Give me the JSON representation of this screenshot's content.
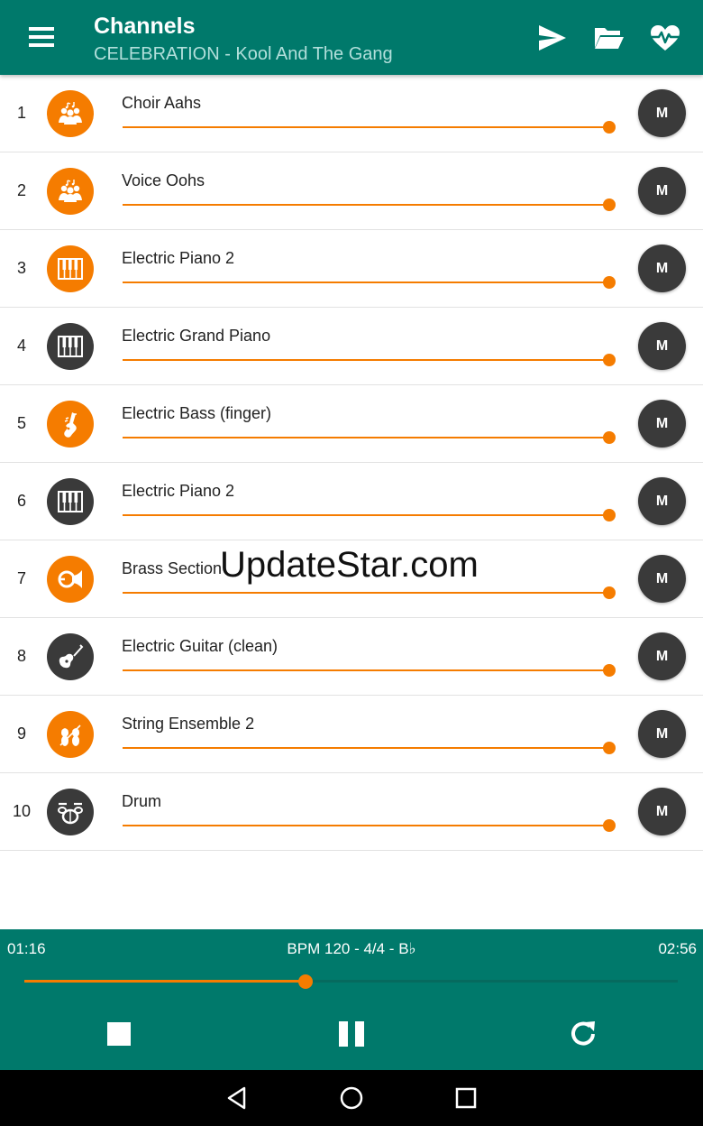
{
  "header": {
    "title": "Channels",
    "subtitle": "CELEBRATION - Kool And The Gang",
    "icons": [
      "menu-icon",
      "send-icon",
      "folder-open-icon",
      "heart-pulse-icon"
    ]
  },
  "colors": {
    "primary": "#00796b",
    "accent": "#f57c00",
    "dark": "#3a3a3a"
  },
  "channels": [
    {
      "number": "1",
      "name": "Choir Aahs",
      "icon": "choir",
      "tone": "orange",
      "volume": 1.0,
      "mute_label": "M"
    },
    {
      "number": "2",
      "name": "Voice Oohs",
      "icon": "choir",
      "tone": "orange",
      "volume": 1.0,
      "mute_label": "M"
    },
    {
      "number": "3",
      "name": "Electric Piano 2",
      "icon": "piano",
      "tone": "orange",
      "volume": 1.0,
      "mute_label": "M"
    },
    {
      "number": "4",
      "name": "Electric Grand Piano",
      "icon": "piano",
      "tone": "dark",
      "volume": 1.0,
      "mute_label": "M"
    },
    {
      "number": "5",
      "name": "Electric Bass (finger)",
      "icon": "bass",
      "tone": "orange",
      "volume": 1.0,
      "mute_label": "M"
    },
    {
      "number": "6",
      "name": "Electric Piano 2",
      "icon": "piano",
      "tone": "dark",
      "volume": 1.0,
      "mute_label": "M"
    },
    {
      "number": "7",
      "name": "Brass Section",
      "icon": "horn",
      "tone": "orange",
      "volume": 1.0,
      "mute_label": "M"
    },
    {
      "number": "8",
      "name": "Electric Guitar (clean)",
      "icon": "guitar",
      "tone": "dark",
      "volume": 1.0,
      "mute_label": "M"
    },
    {
      "number": "9",
      "name": "String Ensemble 2",
      "icon": "strings",
      "tone": "orange",
      "volume": 1.0,
      "mute_label": "M"
    },
    {
      "number": "10",
      "name": "Drum",
      "icon": "drum",
      "tone": "dark",
      "volume": 1.0,
      "mute_label": "M"
    }
  ],
  "watermark": "UpdateStar.com",
  "player": {
    "elapsed": "01:16",
    "total": "02:56",
    "info": "BPM 120 - 4/4 - B♭",
    "progress": 0.431,
    "controls": [
      "stop-icon",
      "pause-icon",
      "repeat-icon"
    ]
  },
  "system_nav": [
    "back-icon",
    "home-icon",
    "recents-icon"
  ]
}
